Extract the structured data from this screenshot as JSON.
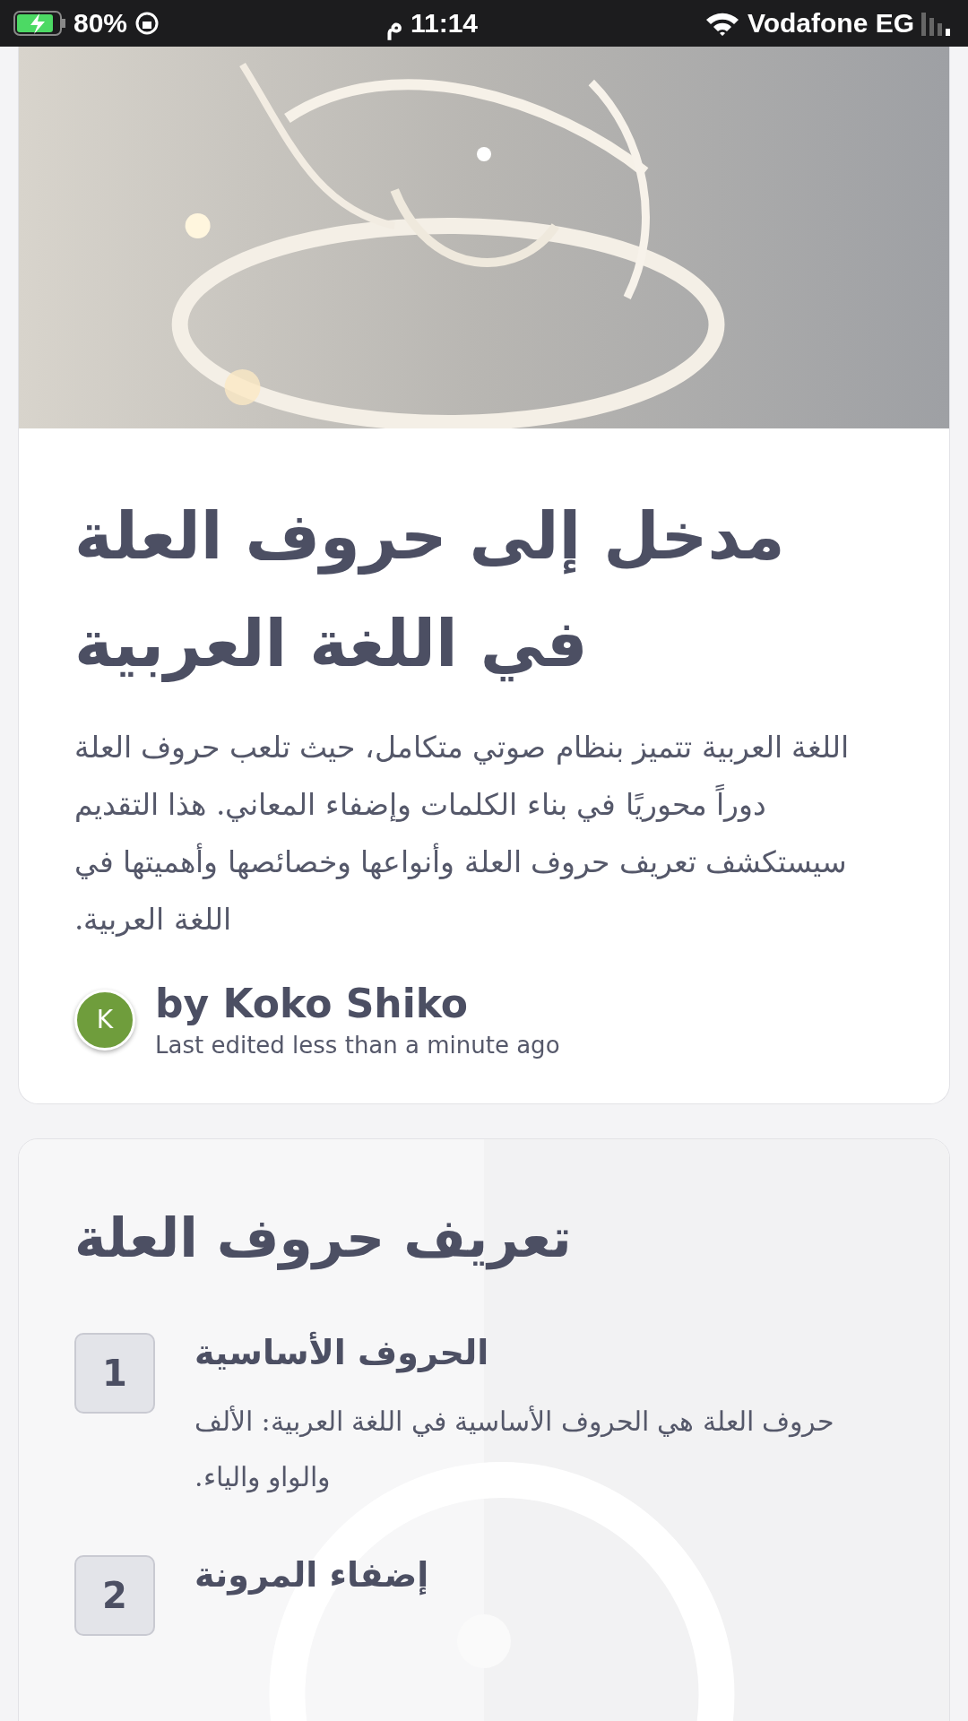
{
  "status_bar": {
    "battery": "80%",
    "time": "11:14",
    "time_suffix": "م",
    "carrier": "Vodafone EG"
  },
  "intro_card": {
    "title": "مدخل إلى حروف العلة في اللغة العربية",
    "body": "اللغة العربية تتميز بنظام صوتي متكامل، حيث تلعب حروف العلة دوراً محوريًا في بناء الكلمات وإضفاء المعاني. هذا التقديم سيستكشف تعريف حروف العلة وأنواعها وخصائصها وأهميتها في اللغة العربية.",
    "author_initial": "K",
    "author": "by Koko Shiko",
    "edited": "Last edited less than a minute ago"
  },
  "section_card": {
    "title": "تعريف حروف العلة",
    "items": [
      {
        "number": "1",
        "title": "الحروف الأساسية",
        "text": "حروف العلة هي الحروف الأساسية في اللغة العربية: الألف والواو والياء."
      },
      {
        "number": "2",
        "title": "إضفاء المرونة"
      }
    ]
  }
}
